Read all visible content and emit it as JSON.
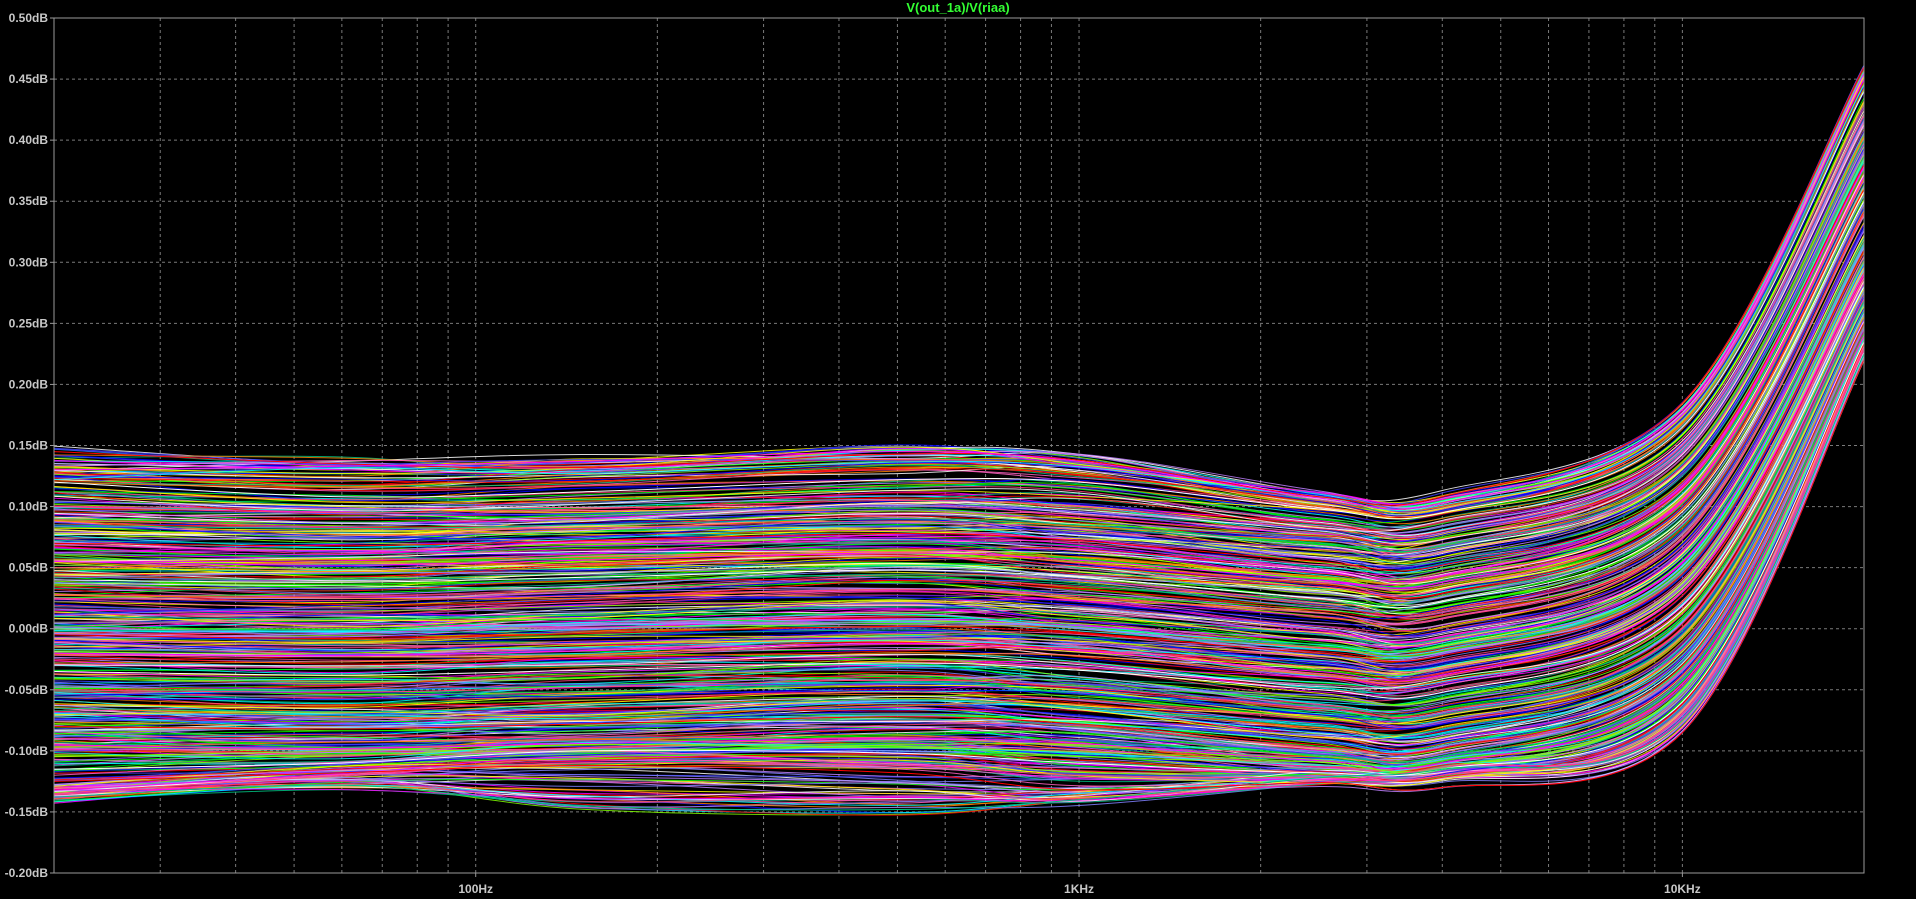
{
  "chart_data": {
    "type": "line",
    "title": "V(out_1a)/V(riaa)",
    "xlabel": "",
    "ylabel": "",
    "x_scale": "log",
    "xlim": [
      20,
      20000
    ],
    "ylim": [
      -0.2,
      0.5
    ],
    "grid": true,
    "background": "#000000",
    "title_color": "#33ff33",
    "y_ticks": [
      {
        "value": 0.5,
        "label": "0.50dB"
      },
      {
        "value": 0.45,
        "label": "0.45dB"
      },
      {
        "value": 0.4,
        "label": "0.40dB"
      },
      {
        "value": 0.35,
        "label": "0.35dB"
      },
      {
        "value": 0.3,
        "label": "0.30dB"
      },
      {
        "value": 0.25,
        "label": "0.25dB"
      },
      {
        "value": 0.2,
        "label": "0.20dB"
      },
      {
        "value": 0.15,
        "label": "0.15dB"
      },
      {
        "value": 0.1,
        "label": "0.10dB"
      },
      {
        "value": 0.05,
        "label": "0.05dB"
      },
      {
        "value": 0.0,
        "label": "0.00dB"
      },
      {
        "value": -0.05,
        "label": "-0.05dB"
      },
      {
        "value": -0.1,
        "label": "-0.10dB"
      },
      {
        "value": -0.15,
        "label": "-0.15dB"
      },
      {
        "value": -0.2,
        "label": "-0.20dB"
      }
    ],
    "x_ticks": [
      {
        "value": 100,
        "label": "100Hz"
      },
      {
        "value": 1000,
        "label": "1KHz"
      },
      {
        "value": 10000,
        "label": "10KHz"
      }
    ],
    "x_minor_grid": [
      30,
      40,
      50,
      60,
      70,
      80,
      90,
      200,
      300,
      400,
      500,
      600,
      700,
      800,
      900,
      2000,
      3000,
      4000,
      5000,
      6000,
      7000,
      8000,
      9000
    ],
    "trace_colors": [
      "#ff0000",
      "#00ff00",
      "#0000ff",
      "#ff00ff",
      "#00ffff",
      "#ffff00",
      "#ffffff",
      "#ff8000",
      "#8080ff",
      "#ff4080",
      "#80ff00",
      "#c080ff",
      "#00c080",
      "#ff60c0",
      "#4040ff"
    ],
    "series": [
      {
        "x": [
          20,
          60,
          150,
          500,
          1000,
          2500,
          4000,
          10000,
          20000
        ],
        "y": [
          0.145,
          0.135,
          0.132,
          0.143,
          0.138,
          0.108,
          0.108,
          0.185,
          0.46
        ]
      },
      {
        "x": [
          20,
          60,
          150,
          500,
          1000,
          2500,
          4000,
          10000,
          20000
        ],
        "y": [
          0.13,
          0.133,
          0.137,
          0.145,
          0.137,
          0.107,
          0.103,
          0.175,
          0.45
        ]
      },
      {
        "x": [
          20,
          60,
          150,
          500,
          1000,
          2500,
          4000,
          10000,
          20000
        ],
        "y": [
          0.12,
          0.108,
          0.112,
          0.122,
          0.12,
          0.098,
          0.095,
          0.165,
          0.44
        ]
      },
      {
        "x": [
          20,
          60,
          150,
          500,
          1000,
          2500,
          4000,
          10000,
          20000
        ],
        "y": [
          0.1,
          0.095,
          0.098,
          0.105,
          0.1,
          0.082,
          0.08,
          0.15,
          0.42
        ]
      },
      {
        "x": [
          20,
          60,
          150,
          500,
          1000,
          2500,
          4000,
          10000,
          20000
        ],
        "y": [
          0.085,
          0.082,
          0.085,
          0.09,
          0.085,
          0.07,
          0.068,
          0.135,
          0.4
        ]
      },
      {
        "x": [
          20,
          60,
          150,
          500,
          1000,
          2500,
          4000,
          10000,
          20000
        ],
        "y": [
          0.07,
          0.068,
          0.072,
          0.078,
          0.072,
          0.055,
          0.052,
          0.12,
          0.38
        ]
      },
      {
        "x": [
          20,
          60,
          150,
          500,
          1000,
          2500,
          4000,
          10000,
          20000
        ],
        "y": [
          0.055,
          0.052,
          0.056,
          0.062,
          0.056,
          0.04,
          0.038,
          0.105,
          0.37
        ]
      },
      {
        "x": [
          20,
          60,
          150,
          500,
          1000,
          2500,
          4000,
          10000,
          20000
        ],
        "y": [
          0.04,
          0.038,
          0.042,
          0.048,
          0.042,
          0.025,
          0.022,
          0.09,
          0.35
        ]
      },
      {
        "x": [
          20,
          60,
          150,
          500,
          1000,
          2500,
          4000,
          10000,
          20000
        ],
        "y": [
          0.025,
          0.023,
          0.027,
          0.032,
          0.027,
          0.01,
          0.008,
          0.075,
          0.34
        ]
      },
      {
        "x": [
          20,
          60,
          150,
          500,
          1000,
          2500,
          4000,
          10000,
          20000
        ],
        "y": [
          0.01,
          0.008,
          0.012,
          0.018,
          0.012,
          -0.005,
          -0.008,
          0.06,
          0.32
        ]
      },
      {
        "x": [
          20,
          60,
          150,
          500,
          1000,
          2500,
          4000,
          10000,
          20000
        ],
        "y": [
          -0.005,
          -0.008,
          -0.004,
          0.002,
          -0.004,
          -0.02,
          -0.022,
          0.045,
          0.31
        ]
      },
      {
        "x": [
          20,
          60,
          150,
          500,
          1000,
          2500,
          4000,
          10000,
          20000
        ],
        "y": [
          -0.02,
          -0.022,
          -0.018,
          -0.012,
          -0.018,
          -0.035,
          -0.038,
          0.03,
          0.29
        ]
      },
      {
        "x": [
          20,
          60,
          150,
          500,
          1000,
          2500,
          4000,
          10000,
          20000
        ],
        "y": [
          -0.035,
          -0.038,
          -0.034,
          -0.028,
          -0.034,
          -0.05,
          -0.052,
          0.015,
          0.28
        ]
      },
      {
        "x": [
          20,
          60,
          150,
          500,
          1000,
          2500,
          4000,
          10000,
          20000
        ],
        "y": [
          -0.05,
          -0.052,
          -0.048,
          -0.042,
          -0.048,
          -0.065,
          -0.068,
          0.0,
          0.27
        ]
      },
      {
        "x": [
          20,
          60,
          150,
          500,
          1000,
          2500,
          4000,
          10000,
          20000
        ],
        "y": [
          -0.065,
          -0.068,
          -0.064,
          -0.058,
          -0.064,
          -0.08,
          -0.082,
          -0.015,
          0.26
        ]
      },
      {
        "x": [
          20,
          60,
          150,
          500,
          1000,
          2500,
          4000,
          10000,
          20000
        ],
        "y": [
          -0.08,
          -0.082,
          -0.078,
          -0.072,
          -0.078,
          -0.095,
          -0.098,
          -0.03,
          0.25
        ]
      },
      {
        "x": [
          20,
          60,
          150,
          500,
          1000,
          2500,
          4000,
          10000,
          20000
        ],
        "y": [
          -0.095,
          -0.098,
          -0.094,
          -0.09,
          -0.094,
          -0.108,
          -0.11,
          -0.045,
          0.24
        ]
      },
      {
        "x": [
          20,
          60,
          150,
          500,
          1000,
          2500,
          4000,
          10000,
          20000
        ],
        "y": [
          -0.115,
          -0.11,
          -0.1,
          -0.102,
          -0.11,
          -0.118,
          -0.115,
          -0.06,
          0.235
        ]
      },
      {
        "x": [
          20,
          60,
          150,
          500,
          1000,
          2500,
          4000,
          10000,
          20000
        ],
        "y": [
          -0.135,
          -0.12,
          -0.11,
          -0.112,
          -0.12,
          -0.122,
          -0.12,
          -0.07,
          0.23
        ]
      },
      {
        "x": [
          20,
          60,
          150,
          500,
          1000,
          2500,
          4000,
          10000,
          20000
        ],
        "y": [
          -0.138,
          -0.128,
          -0.145,
          -0.148,
          -0.14,
          -0.122,
          -0.115,
          -0.075,
          0.225
        ]
      },
      {
        "x": [
          20,
          60,
          150,
          500,
          1000,
          2500,
          4000,
          10000,
          20000
        ],
        "y": [
          -0.125,
          -0.118,
          -0.112,
          -0.118,
          -0.132,
          -0.126,
          -0.13,
          -0.085,
          0.22
        ]
      }
    ]
  }
}
